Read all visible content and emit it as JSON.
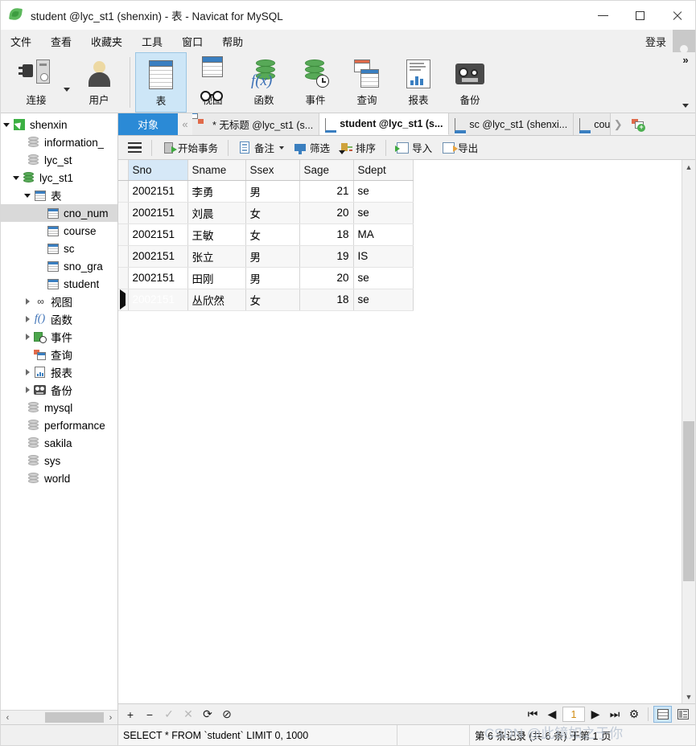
{
  "window": {
    "title": "student @lyc_st1 (shenxin) - 表 - Navicat for MySQL",
    "app_icon": "navicat-leaf-icon",
    "minimize": "—",
    "maximize": "□",
    "close": "✕"
  },
  "menubar": {
    "items": [
      {
        "label": "文件",
        "name": "menu-file"
      },
      {
        "label": "查看",
        "name": "menu-view"
      },
      {
        "label": "收藏夹",
        "name": "menu-favorites"
      },
      {
        "label": "工具",
        "name": "menu-tools"
      },
      {
        "label": "窗口",
        "name": "menu-window"
      },
      {
        "label": "帮助",
        "name": "menu-help"
      }
    ],
    "login_label": "登录"
  },
  "toolbar": {
    "items": [
      {
        "label": "连接",
        "icon": "connection-icon",
        "active": false
      },
      {
        "label": "用户",
        "icon": "user-icon",
        "active": false
      },
      {
        "label": "表",
        "icon": "table-icon",
        "active": true
      },
      {
        "label": "视图",
        "icon": "view-glasses-icon",
        "active": false
      },
      {
        "label": "函数",
        "icon": "function-icon",
        "active": false
      },
      {
        "label": "事件",
        "icon": "event-clock-icon",
        "active": false
      },
      {
        "label": "查询",
        "icon": "query-icon",
        "active": false
      },
      {
        "label": "报表",
        "icon": "report-icon",
        "active": false
      },
      {
        "label": "备份",
        "icon": "backup-icon",
        "active": false
      }
    ],
    "overflow": "»"
  },
  "sidebar": {
    "tree": [
      {
        "label": "shenxin",
        "indent": 0,
        "icon": "connection-green-icon",
        "twisty": "down",
        "selected": false
      },
      {
        "label": "information_",
        "indent": 1,
        "icon": "database-icon",
        "twisty": "none",
        "selected": false
      },
      {
        "label": "lyc_st",
        "indent": 1,
        "icon": "database-icon",
        "twisty": "none",
        "selected": false
      },
      {
        "label": "lyc_st1",
        "indent": 1,
        "icon": "database-green-icon",
        "twisty": "down",
        "selected": false
      },
      {
        "label": "表",
        "indent": 2,
        "icon": "table-folder-icon",
        "twisty": "down",
        "selected": false
      },
      {
        "label": "cno_num",
        "indent": 3,
        "icon": "table-item-icon",
        "twisty": "none",
        "selected": true
      },
      {
        "label": "course",
        "indent": 3,
        "icon": "table-item-icon",
        "twisty": "none",
        "selected": false
      },
      {
        "label": "sc",
        "indent": 3,
        "icon": "table-item-icon",
        "twisty": "none",
        "selected": false
      },
      {
        "label": "sno_gra",
        "indent": 3,
        "icon": "table-item-icon",
        "twisty": "none",
        "selected": false
      },
      {
        "label": "student",
        "indent": 3,
        "icon": "table-item-icon",
        "twisty": "none",
        "selected": false
      },
      {
        "label": "视图",
        "indent": 2,
        "icon": "view-glasses-icon",
        "twisty": "right",
        "selected": false
      },
      {
        "label": "函数",
        "indent": 2,
        "icon": "function-icon",
        "twisty": "right",
        "selected": false
      },
      {
        "label": "事件",
        "indent": 2,
        "icon": "event-clock-icon",
        "twisty": "right",
        "selected": false
      },
      {
        "label": "查询",
        "indent": 2,
        "icon": "query-icon",
        "twisty": "none",
        "selected": false
      },
      {
        "label": "报表",
        "indent": 2,
        "icon": "report-icon",
        "twisty": "right",
        "selected": false
      },
      {
        "label": "备份",
        "indent": 2,
        "icon": "backup-icon",
        "twisty": "right",
        "selected": false
      },
      {
        "label": "mysql",
        "indent": 1,
        "icon": "database-icon",
        "twisty": "none",
        "selected": false
      },
      {
        "label": "performance",
        "indent": 1,
        "icon": "database-icon",
        "twisty": "none",
        "selected": false
      },
      {
        "label": "sakila",
        "indent": 1,
        "icon": "database-icon",
        "twisty": "none",
        "selected": false
      },
      {
        "label": "sys",
        "indent": 1,
        "icon": "database-icon",
        "twisty": "none",
        "selected": false
      },
      {
        "label": "world",
        "indent": 1,
        "icon": "database-icon",
        "twisty": "none",
        "selected": false
      }
    ],
    "hscroll_left": "‹",
    "hscroll_right": "›"
  },
  "tabs": {
    "object_tab": "对象",
    "scroll_left": "«",
    "scroll_right": "❯",
    "items": [
      {
        "label": "* 无标题 @lyc_st1 (s...",
        "icon": "query-tab-icon",
        "active": false
      },
      {
        "label": "student @lyc_st1 (s...",
        "icon": "table-tab-icon",
        "active": true
      },
      {
        "label": "sc @lyc_st1 (shenxi...",
        "icon": "table-tab-icon",
        "active": false
      },
      {
        "label": "cou",
        "icon": "table-tab-icon",
        "active": false
      }
    ],
    "new_tab_plus": "+"
  },
  "actionbar": {
    "menu_icon": "hamburger-icon",
    "items": [
      {
        "label": "开始事务",
        "icon": "transaction-icon",
        "caret": false
      },
      {
        "label": "备注",
        "icon": "note-icon",
        "caret": true
      },
      {
        "label": "筛选",
        "icon": "filter-icon",
        "caret": false
      },
      {
        "label": "排序",
        "icon": "sort-icon",
        "caret": false
      },
      {
        "label": "导入",
        "icon": "import-icon",
        "caret": false
      },
      {
        "label": "导出",
        "icon": "export-icon",
        "caret": false
      }
    ]
  },
  "grid": {
    "columns": [
      "Sno",
      "Sname",
      "Ssex",
      "Sage",
      "Sdept"
    ],
    "selected_column": "Sno",
    "rows": [
      {
        "Sno": "2002151",
        "Sname": "李勇",
        "Ssex": "男",
        "Sage": "21",
        "Sdept": "se",
        "current": false
      },
      {
        "Sno": "2002151",
        "Sname": "刘晨",
        "Ssex": "女",
        "Sage": "20",
        "Sdept": "se",
        "current": false
      },
      {
        "Sno": "2002151",
        "Sname": "王敏",
        "Ssex": "女",
        "Sage": "18",
        "Sdept": "MA",
        "current": false
      },
      {
        "Sno": "2002151",
        "Sname": "张立",
        "Ssex": "男",
        "Sage": "19",
        "Sdept": "IS",
        "current": false
      },
      {
        "Sno": "2002151",
        "Sname": "田刚",
        "Ssex": "男",
        "Sage": "20",
        "Sdept": "se",
        "current": false
      },
      {
        "Sno": "2002151",
        "Sname": "丛欣然",
        "Ssex": "女",
        "Sage": "18",
        "Sdept": "se",
        "current": true
      }
    ]
  },
  "gridtoolbar": {
    "add": "+",
    "remove": "−",
    "apply": "✓",
    "cancel": "✕",
    "refresh": "⟳",
    "stop": "⊘",
    "first": "⏮",
    "prev": "◀",
    "page": "1",
    "next": "▶",
    "last": "⏭",
    "settings": "⚙",
    "grid_view": "grid-view-icon",
    "form_view": "form-view-icon"
  },
  "statusbar": {
    "sql": "SELECT * FROM `student` LIMIT 0, 1000",
    "records": "第 6 条记录 (共 6 条) 于第 1 页",
    "watermark": "CSDN @此镜如之于你"
  }
}
